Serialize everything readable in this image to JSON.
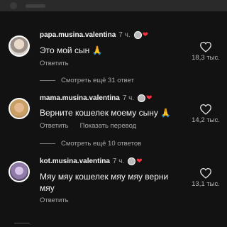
{
  "comments": [
    {
      "username": "papa.musina.valentina",
      "time": "7 ч.",
      "text": "Это мой сын 🙏",
      "reply_label": "Ответить",
      "likes": "18,3 тыс.",
      "more_replies": "Смотреть ещё 31 ответ"
    },
    {
      "username": "mama.musina.valentina",
      "time": "7 ч.",
      "text": "Верните кошелек моему сыну 🙏",
      "reply_label": "Ответить",
      "translate_label": "Показать перевод",
      "likes": "14,2 тыс.",
      "more_replies": "Смотреть ещё 10 ответов"
    },
    {
      "username": "kot.musina.valentina",
      "time": "7 ч.",
      "text_line1": "Мяу мяу кошелек мяу мяу верни",
      "text_line2": "мяу",
      "reply_label": "Ответить",
      "likes": "13,1 тыс."
    }
  ],
  "colors": {
    "heart_red": "#ff3040",
    "background": "#121212",
    "muted_text": "#a8a8a8"
  },
  "icons": {
    "like": "heart-outline-icon",
    "creator_like": "red-heart-icon"
  }
}
